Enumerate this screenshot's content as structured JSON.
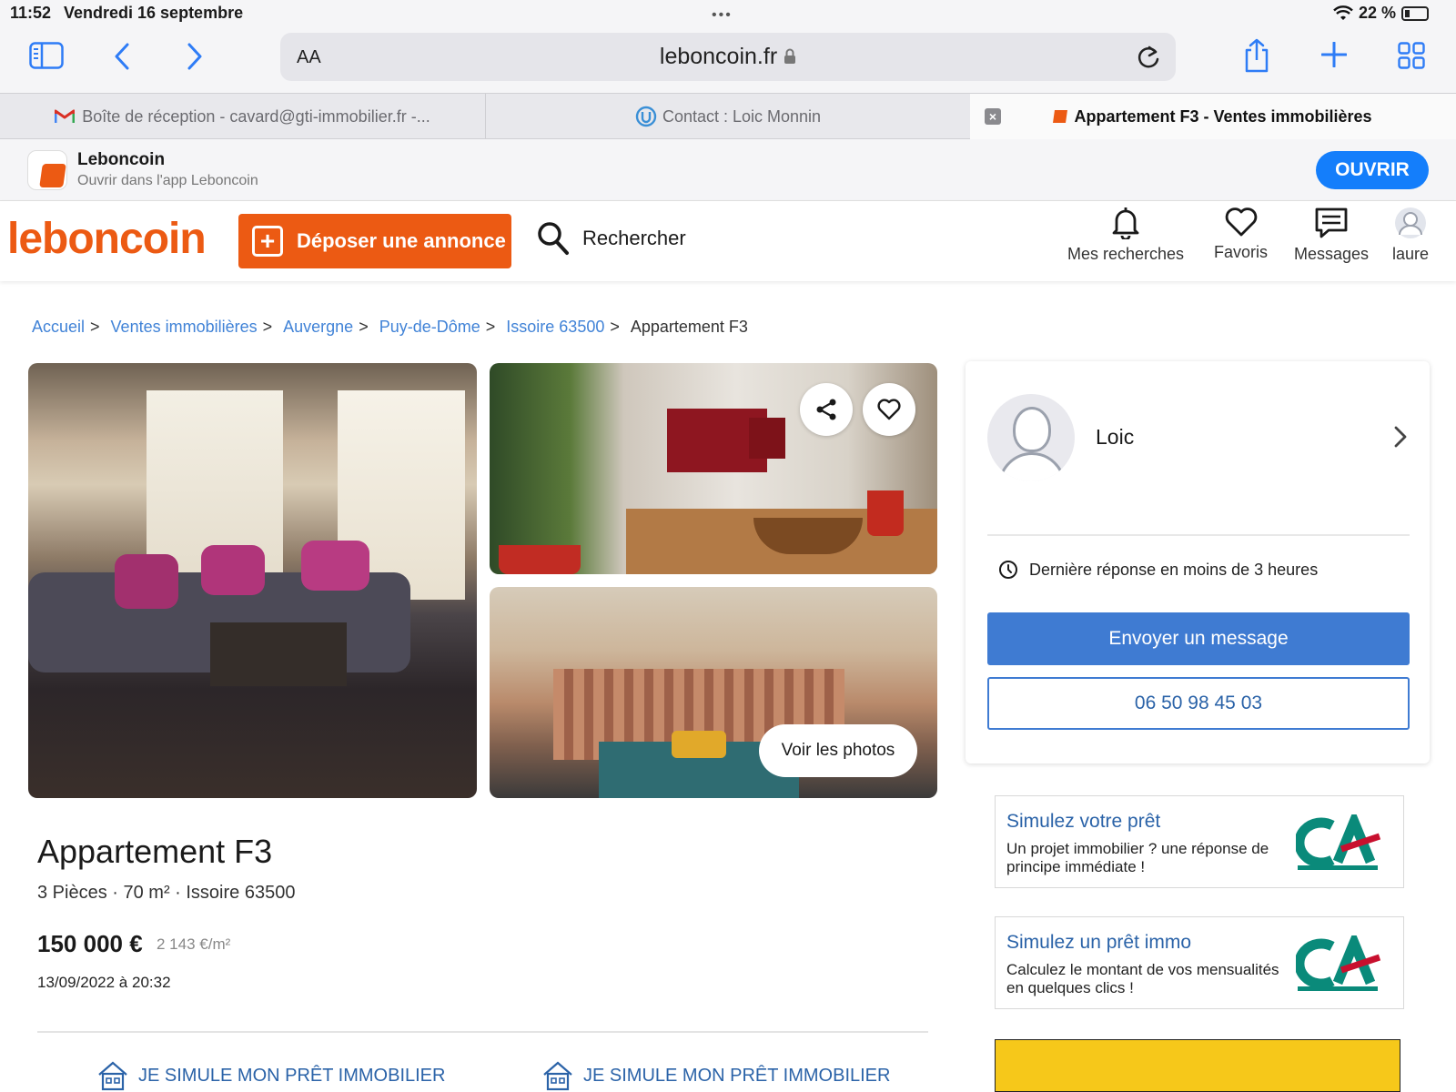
{
  "status": {
    "time": "11:52",
    "date": "Vendredi 16 septembre",
    "battery": "22 %"
  },
  "browser": {
    "text_size": "AA",
    "url": "leboncoin.fr",
    "tabs": [
      {
        "label": "Boîte de réception - cavard@gti-immobilier.fr -...",
        "icon": "gmail-icon"
      },
      {
        "label": "Contact : Loic Monnin",
        "icon": "crm-icon"
      },
      {
        "label": "Appartement F3 - Ventes immobilières",
        "icon": "leboncoin-icon"
      }
    ]
  },
  "app_banner": {
    "name": "Leboncoin",
    "subtitle": "Ouvrir dans l'app Leboncoin",
    "open_label": "OUVRIR"
  },
  "header": {
    "logo": "leboncoin",
    "deposer_label": "Déposer une annonce",
    "search_label": "Rechercher",
    "nav": [
      {
        "label": "Mes recherches",
        "icon": "bell-icon"
      },
      {
        "label": "Favoris",
        "icon": "heart-icon"
      },
      {
        "label": "Messages",
        "icon": "message-icon"
      },
      {
        "label": "laure",
        "icon": "user-avatar-icon"
      }
    ]
  },
  "breadcrumb": {
    "items": [
      "Accueil",
      "Ventes immobilières",
      "Auvergne",
      "Puy-de-Dôme",
      "Issoire 63500"
    ],
    "current": "Appartement F3",
    "separator": ">"
  },
  "gallery": {
    "see_photos_label": "Voir les photos"
  },
  "ad": {
    "title": "Appartement F3",
    "details": "3 Pièces · 70 m² · Issoire 63500",
    "price": "150 000 €",
    "price_per_m2": "2 143 €/m²",
    "date": "13/09/2022 à 20:32",
    "simulate_links": [
      "JE SIMULE MON PRÊT IMMOBILIER",
      "JE SIMULE MON PRÊT IMMOBILIER"
    ]
  },
  "seller": {
    "name": "Loic",
    "response_time": "Dernière réponse en moins de 3 heures",
    "message_label": "Envoyer un message",
    "phone": "06 50 98 45 03"
  },
  "promos": [
    {
      "title": "Simulez votre prêt",
      "text": "Un projet immobilier ? une réponse de principe immédiate !"
    },
    {
      "title": "Simulez un prêt immo",
      "text": "Calculez le montant de vos mensualités en quelques clics !"
    }
  ],
  "colors": {
    "brand": "#ec5a13",
    "link": "#4183d7",
    "primary_button": "#3f7bd2",
    "ios_blue": "#147efb"
  }
}
